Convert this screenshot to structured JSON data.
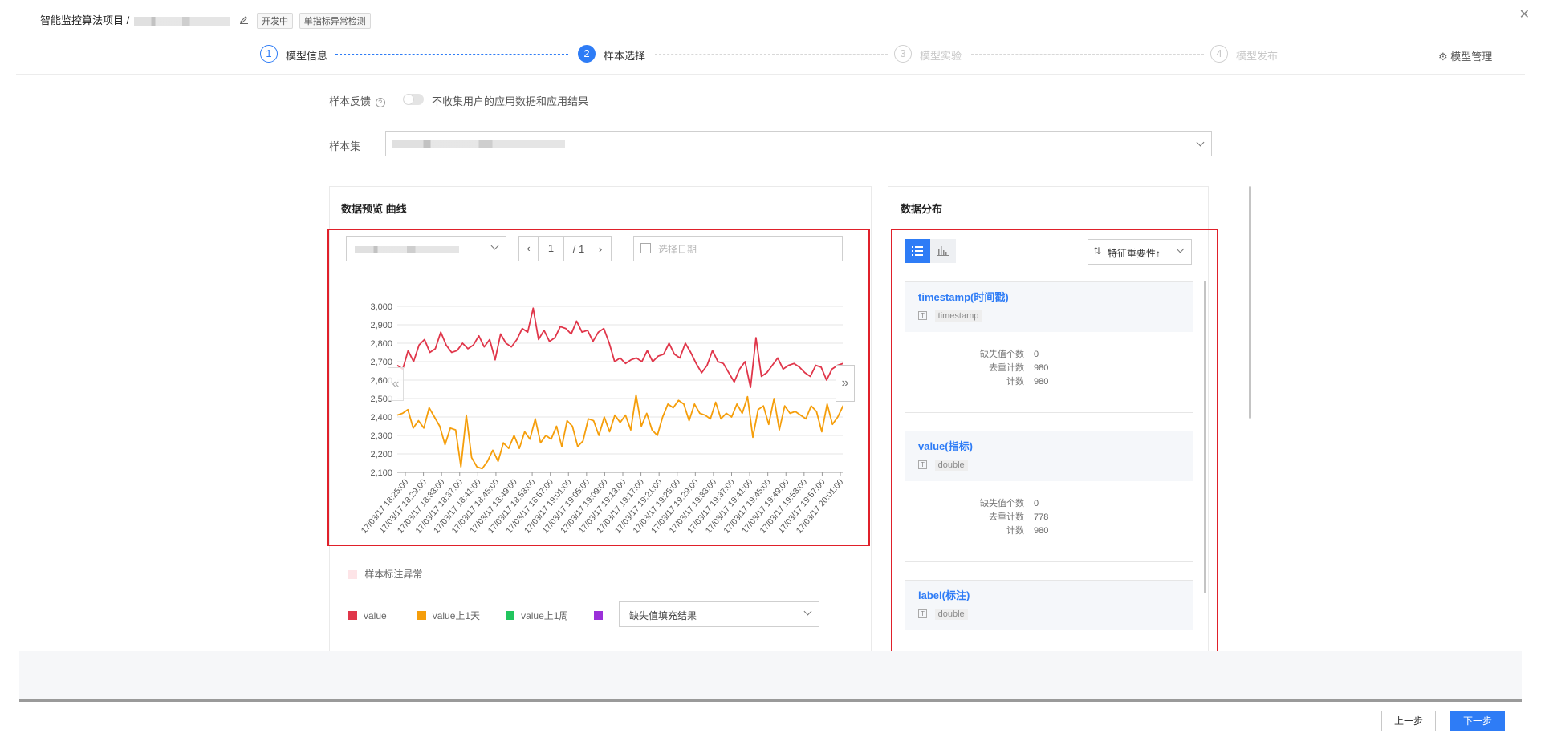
{
  "header": {
    "project_title": "智能监控算法项目 /",
    "status_tag": "开发中",
    "type_tag": "单指标异常检测"
  },
  "steps": [
    {
      "num": "1",
      "label": "模型信息",
      "state": "done"
    },
    {
      "num": "2",
      "label": "样本选择",
      "state": "active"
    },
    {
      "num": "3",
      "label": "模型实验",
      "state": "disabled"
    },
    {
      "num": "4",
      "label": "模型发布",
      "state": "disabled"
    }
  ],
  "model_manage": "模型管理",
  "form": {
    "feedback_label": "样本反馈",
    "feedback_toggle_text": "不收集用户的应用数据和应用结果",
    "feedback_enabled": false,
    "sample_set_label": "样本集"
  },
  "preview": {
    "title": "数据预览 曲线",
    "page_current": "1",
    "page_total": "/ 1",
    "date_placeholder": "选择日期",
    "anomaly_legend": "样本标注异常",
    "legend": [
      {
        "label": "value",
        "color": "#e0364a"
      },
      {
        "label": "value上1天",
        "color": "#f59e0b"
      },
      {
        "label": "value上1周",
        "color": "#22c55e"
      },
      {
        "label": "",
        "color": "#9b30d9"
      }
    ],
    "fill_select": "缺失值填充结果"
  },
  "distribution": {
    "title": "数据分布",
    "sort_select": "特征重要性↑",
    "cards": [
      {
        "title": "timestamp(时间戳)",
        "type": "timestamp",
        "stats": [
          {
            "k": "缺失值个数",
            "v": "0"
          },
          {
            "k": "去重计数",
            "v": "980"
          },
          {
            "k": "计数",
            "v": "980"
          }
        ]
      },
      {
        "title": "value(指标)",
        "type": "double",
        "stats": [
          {
            "k": "缺失值个数",
            "v": "0"
          },
          {
            "k": "去重计数",
            "v": "778"
          },
          {
            "k": "计数",
            "v": "980"
          }
        ]
      },
      {
        "title": "label(标注)",
        "type": "double",
        "stats": []
      }
    ]
  },
  "footer": {
    "prev": "上一步",
    "next": "下一步"
  },
  "icons": {
    "edit": "edit-icon",
    "help": "help-icon",
    "gear": "gear-icon",
    "calendar": "calendar-icon",
    "list": "list-view-icon",
    "bar": "bar-view-icon",
    "sort": "sort-icon"
  },
  "colors": {
    "primary": "#2e7cf6",
    "highlight_box": "#e0202a"
  },
  "chart_data": {
    "type": "line",
    "yticks": [
      "3,000",
      "2,900",
      "2,800",
      "2,700",
      "2,600",
      "2,500",
      "2,400",
      "2,300",
      "2,200",
      "2,100"
    ],
    "ylim": [
      2100,
      3000
    ],
    "x": [
      "17/03/17 18:25:00",
      "17/03/17 18:29:00",
      "17/03/17 18:33:00",
      "17/03/17 18:37:00",
      "17/03/17 18:41:00",
      "17/03/17 18:45:00",
      "17/03/17 18:49:00",
      "17/03/17 18:53:00",
      "17/03/17 18:57:00",
      "17/03/17 19:01:00",
      "17/03/17 19:05:00",
      "17/03/17 19:09:00",
      "17/03/17 19:13:00",
      "17/03/17 19:17:00",
      "17/03/17 19:21:00",
      "17/03/17 19:25:00",
      "17/03/17 19:29:00",
      "17/03/17 19:33:00",
      "17/03/17 19:37:00",
      "17/03/17 19:41:00",
      "17/03/17 19:45:00",
      "17/03/17 19:49:00",
      "17/03/17 19:53:00",
      "17/03/17 19:57:00",
      "17/03/17 20:01:00"
    ],
    "series": [
      {
        "name": "value",
        "color": "#e0364a",
        "values": [
          2680,
          2660,
          2760,
          2700,
          2790,
          2820,
          2750,
          2770,
          2860,
          2790,
          2750,
          2760,
          2800,
          2770,
          2790,
          2840,
          2780,
          2820,
          2710,
          2850,
          2800,
          2780,
          2820,
          2880,
          2860,
          2990,
          2820,
          2870,
          2810,
          2830,
          2890,
          2880,
          2850,
          2920,
          2860,
          2870,
          2810,
          2860,
          2880,
          2800,
          2700,
          2720,
          2690,
          2710,
          2720,
          2700,
          2760,
          2700,
          2730,
          2740,
          2800,
          2740,
          2720,
          2800,
          2750,
          2690,
          2640,
          2680,
          2760,
          2700,
          2690,
          2640,
          2590,
          2660,
          2700,
          2560,
          2830,
          2620,
          2640,
          2680,
          2720,
          2660,
          2680,
          2690,
          2670,
          2640,
          2620,
          2680,
          2670,
          2600,
          2660,
          2680,
          2690,
          2710
        ],
        "comment": "approximate"
      },
      {
        "name": "value上1天",
        "color": "#f59e0b",
        "values": [
          2410,
          2420,
          2440,
          2340,
          2380,
          2340,
          2450,
          2400,
          2350,
          2250,
          2340,
          2330,
          2130,
          2410,
          2180,
          2130,
          2120,
          2160,
          2220,
          2160,
          2260,
          2230,
          2300,
          2230,
          2320,
          2280,
          2390,
          2260,
          2300,
          2280,
          2350,
          2240,
          2380,
          2350,
          2240,
          2270,
          2390,
          2380,
          2300,
          2400,
          2320,
          2410,
          2370,
          2410,
          2330,
          2520,
          2350,
          2420,
          2330,
          2300,
          2400,
          2470,
          2450,
          2490,
          2470,
          2380,
          2470,
          2420,
          2410,
          2390,
          2480,
          2390,
          2420,
          2400,
          2470,
          2420,
          2510,
          2290,
          2440,
          2460,
          2360,
          2500,
          2330,
          2460,
          2420,
          2430,
          2410,
          2390,
          2460,
          2430,
          2320,
          2470,
          2360,
          2400,
          2460,
          2370
        ]
      }
    ]
  }
}
